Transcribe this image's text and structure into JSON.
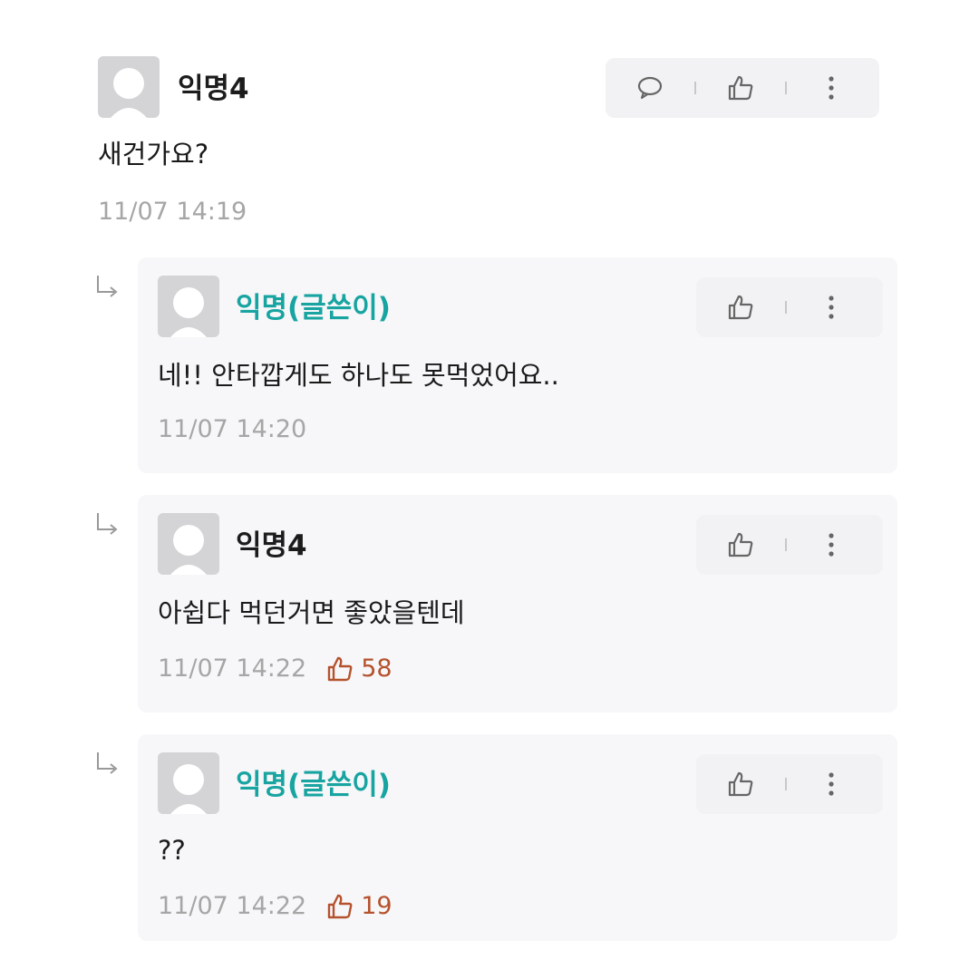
{
  "comments": [
    {
      "author": "익명4",
      "is_op": false,
      "text": "새건가요?",
      "time": "11/07 14:19",
      "likes": null,
      "actions": [
        "reply-icon",
        "thumbs-up-icon",
        "more-vertical-icon"
      ]
    },
    {
      "author": "익명(글쓴이)",
      "is_op": true,
      "text": "네!! 안타깝게도 하나도 못먹었어요..",
      "time": "11/07 14:20",
      "likes": null,
      "actions": [
        "thumbs-up-icon",
        "more-vertical-icon"
      ]
    },
    {
      "author": "익명4",
      "is_op": false,
      "text": "아쉽다 먹던거면 좋았을텐데",
      "time": "11/07 14:22",
      "likes": "58",
      "actions": [
        "thumbs-up-icon",
        "more-vertical-icon"
      ]
    },
    {
      "author": "익명(글쓴이)",
      "is_op": true,
      "text": "??",
      "time": "11/07 14:22",
      "likes": "19",
      "actions": [
        "thumbs-up-icon",
        "more-vertical-icon"
      ]
    }
  ],
  "colors": {
    "op_author": "#18a4a1",
    "author": "#1c1c1c",
    "like_count": "#b5522e",
    "timestamp": "#a6a6a6",
    "reply_background": "#f7f7f9"
  }
}
